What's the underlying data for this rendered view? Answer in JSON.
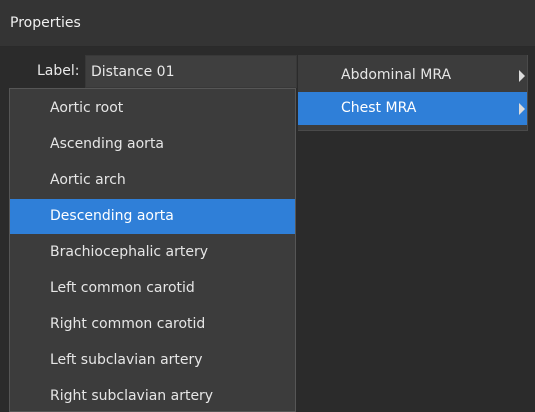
{
  "panel": {
    "title": "Properties"
  },
  "label_field": {
    "caption": "Label:",
    "value": "Distance 01"
  },
  "submenu": {
    "items": [
      {
        "label": "Abdominal MRA",
        "selected": false,
        "icon": "chevron-right-icon"
      },
      {
        "label": "Chest MRA",
        "selected": true,
        "icon": "chevron-right-icon"
      }
    ]
  },
  "dropdown": {
    "items": [
      {
        "label": "Aortic root",
        "selected": false
      },
      {
        "label": "Ascending aorta",
        "selected": false
      },
      {
        "label": "Aortic arch",
        "selected": false
      },
      {
        "label": "Descending aorta",
        "selected": true
      },
      {
        "label": "Brachiocephalic artery",
        "selected": false
      },
      {
        "label": "Left common carotid",
        "selected": false
      },
      {
        "label": "Right common carotid",
        "selected": false
      },
      {
        "label": "Left subclavian artery",
        "selected": false
      },
      {
        "label": "Right subclavian artery",
        "selected": false
      }
    ]
  },
  "colors": {
    "background": "#2b2b2b",
    "header": "#343434",
    "menu_background": "#3c3c3c",
    "selection": "#2f7fd8",
    "text": "#e6e6e6"
  }
}
